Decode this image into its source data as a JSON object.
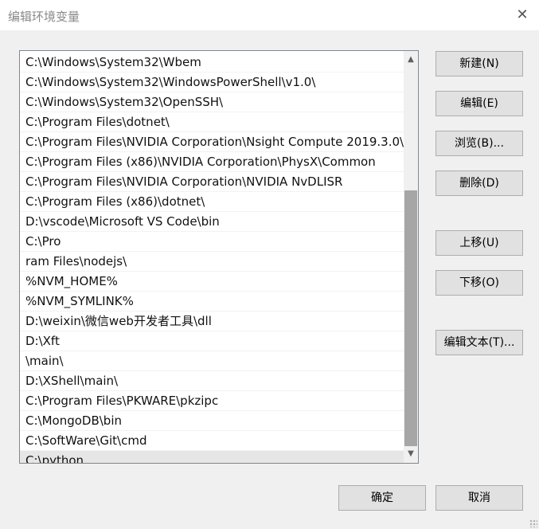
{
  "window": {
    "title": "编辑环境变量",
    "close_glyph": "✕"
  },
  "paths": [
    "C:\\Windows\\System32\\Wbem",
    "C:\\Windows\\System32\\WindowsPowerShell\\v1.0\\",
    "C:\\Windows\\System32\\OpenSSH\\",
    "C:\\Program Files\\dotnet\\",
    "C:\\Program Files\\NVIDIA Corporation\\Nsight Compute 2019.3.0\\",
    "C:\\Program Files (x86)\\NVIDIA Corporation\\PhysX\\Common",
    "C:\\Program Files\\NVIDIA Corporation\\NVIDIA NvDLISR",
    "C:\\Program Files (x86)\\dotnet\\",
    "D:\\vscode\\Microsoft VS Code\\bin",
    "C:\\Pro",
    "ram Files\\nodejs\\",
    "%NVM_HOME%",
    "%NVM_SYMLINK%",
    "D:\\weixin\\微信web开发者工具\\dll",
    "D:\\Xft",
    "\\main\\",
    "D:\\XShell\\main\\",
    "C:\\Program Files\\PKWARE\\pkzipc",
    "C:\\MongoDB\\bin",
    "C:\\SoftWare\\Git\\cmd",
    "C:\\python"
  ],
  "selected_index": 20,
  "scrollbar": {
    "up_glyph": "▲",
    "down_glyph": "▼"
  },
  "buttons": {
    "new": "新建(N)",
    "edit": "编辑(E)",
    "browse": "浏览(B)...",
    "delete": "删除(D)",
    "move_up": "上移(U)",
    "move_down": "下移(O)",
    "edit_text": "编辑文本(T)...",
    "ok": "确定",
    "cancel": "取消"
  }
}
